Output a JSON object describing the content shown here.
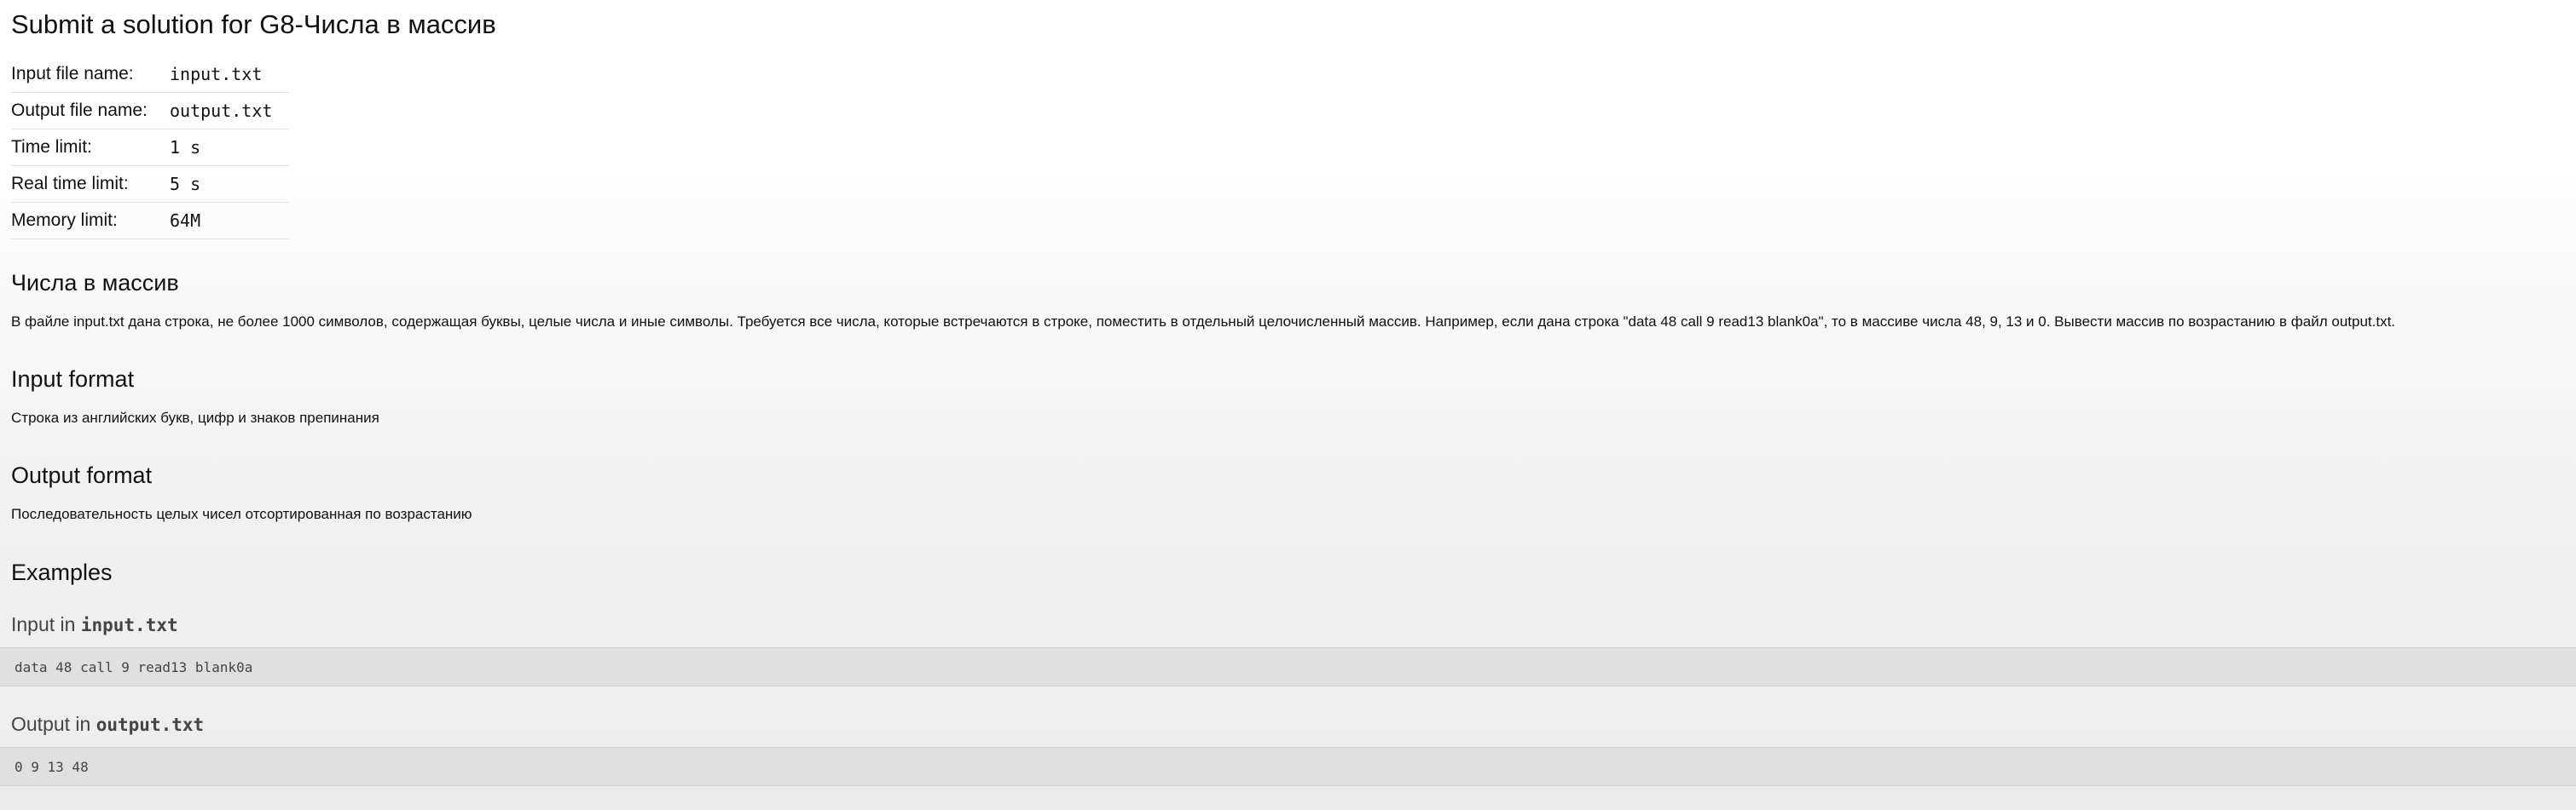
{
  "page_title": "Submit a solution for G8-Числа в массив",
  "info": [
    {
      "label": "Input file name:",
      "value": "input.txt"
    },
    {
      "label": "Output file name:",
      "value": "output.txt"
    },
    {
      "label": "Time limit:",
      "value": "1 s"
    },
    {
      "label": "Real time limit:",
      "value": "5 s"
    },
    {
      "label": "Memory limit:",
      "value": "64M"
    }
  ],
  "statement": {
    "heading": "Числа в массив",
    "text": "В файле input.txt дана строка, не более 1000 символов, содержащая буквы, целые числа и иные символы. Требуется все числа, которые встречаются в строке, поместить в отдельный целочисленный массив. Например, если дана строка \"data 48 call 9 read13 blank0a\", то в массиве числа 48, 9, 13 и 0. Вывести массив по возрастанию в файл output.txt."
  },
  "input_format": {
    "heading": "Input format",
    "text": "Строка из английских букв, цифр и знаков препинания"
  },
  "output_format": {
    "heading": "Output format",
    "text": "Последовательность целых чисел отсортированная по возрастанию"
  },
  "examples": {
    "heading": "Examples",
    "input_label": "Input in",
    "input_file": "input.txt",
    "input_value": "data 48 call 9 read13 blank0a",
    "output_label": "Output in",
    "output_file": "output.txt",
    "output_value": "0 9 13 48"
  }
}
